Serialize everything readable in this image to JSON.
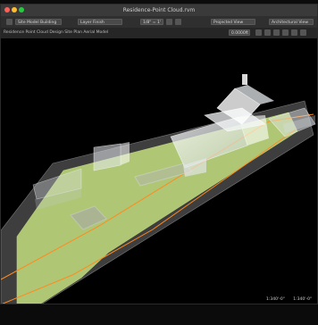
{
  "window": {
    "title": "Residence-Point Cloud.rvm"
  },
  "toolbar": {
    "dropdown_1": "Site Model Building",
    "dropdown_2": "Layer Finish",
    "scale_value": "1/8\" = 1'",
    "dropdown_3": "Projected View",
    "dropdown_4": "Architectural View",
    "field_right": "0.0000ft"
  },
  "view": {
    "label": "Residence Point Cloud Design Site Plan Aerial Model"
  },
  "status": {
    "left": "1:340'-0\"",
    "right": "1:340'-0\""
  },
  "colors": {
    "lawn": "#b9d27a",
    "outline": "#ff8a1f",
    "building": "#e9eef3"
  }
}
